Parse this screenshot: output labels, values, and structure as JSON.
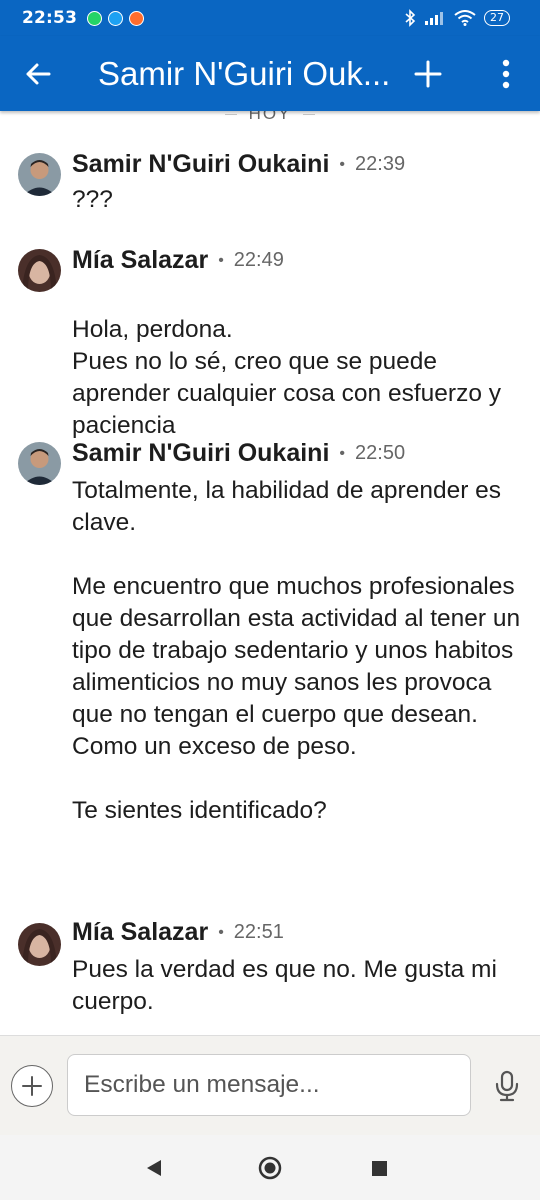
{
  "status_bar": {
    "time": "22:53",
    "battery": "27"
  },
  "header": {
    "title": "Samir N'Guiri Ouk..."
  },
  "day_divider": "HOY",
  "messages": [
    {
      "author": "Samir N'Guiri Oukaini",
      "time": "22:39",
      "paragraphs": [
        "???"
      ]
    },
    {
      "author": "Mía Salazar",
      "time": "22:49",
      "paragraphs": [
        "Hola, perdona.\nPues no lo sé, creo que se puede aprender cualquier cosa con esfuerzo y paciencia"
      ]
    },
    {
      "author": "Samir N'Guiri Oukaini",
      "time": "22:50",
      "paragraphs": [
        "Totalmente, la habilidad de aprender es clave.",
        "Me encuentro que muchos profesionales que desarrollan esta actividad al tener un tipo de trabajo sedentario y unos habitos alimenticios no muy sanos les provoca que no tengan el cuerpo que desean. Como un exceso de peso.",
        "Te sientes identificado?"
      ]
    },
    {
      "author": "Mía Salazar",
      "time": "22:51",
      "paragraphs": [
        "Pues la verdad es que no. Me gusta mi cuerpo."
      ]
    }
  ],
  "composer": {
    "placeholder": "Escribe un mensaje..."
  },
  "colors": {
    "brand": "#0a66c2"
  }
}
